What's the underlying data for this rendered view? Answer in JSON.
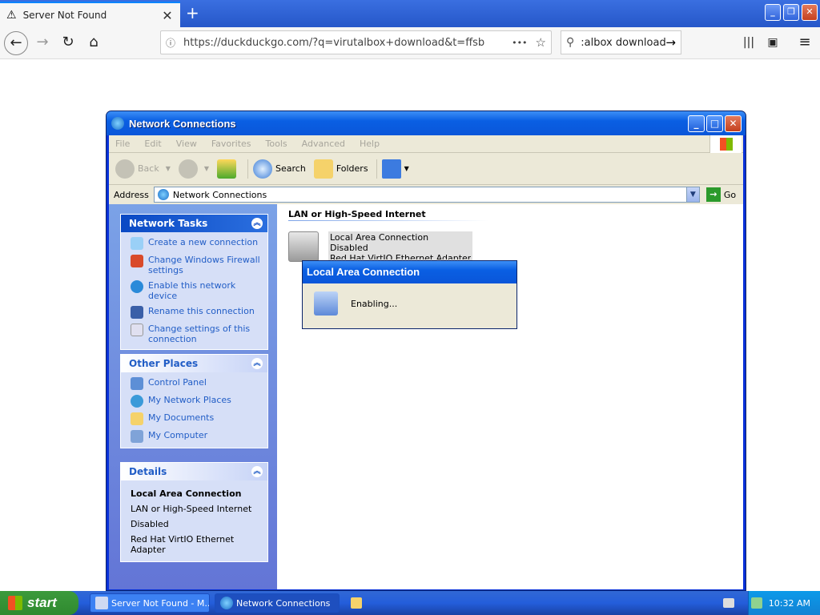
{
  "browser": {
    "tab_title": "Server Not Found",
    "tab_close": "✕",
    "new_tab": "+",
    "url": "https://duckduckgo.com/?q=virutalbox+download&t=ffsb",
    "search_text": ":albox download",
    "url_more": "•••"
  },
  "window": {
    "title": "Network Connections",
    "menu": [
      "File",
      "Edit",
      "View",
      "Favorites",
      "Tools",
      "Advanced",
      "Help"
    ],
    "toolbar": {
      "back": "Back",
      "search": "Search",
      "folders": "Folders"
    },
    "address_label": "Address",
    "address_value": "Network Connections",
    "go_label": "Go"
  },
  "tasks": {
    "network_tasks_title": "Network Tasks",
    "network_tasks": [
      "Create a new connection",
      "Change Windows Firewall settings",
      "Enable this network device",
      "Rename this connection",
      "Change settings of this connection"
    ],
    "other_places_title": "Other Places",
    "other_places": [
      "Control Panel",
      "My Network Places",
      "My Documents",
      "My Computer"
    ],
    "details_title": "Details",
    "details": {
      "name": "Local Area Connection",
      "type": "LAN or High-Speed Internet",
      "status": "Disabled",
      "adapter": "Red Hat VirtIO Ethernet Adapter"
    }
  },
  "content": {
    "group_header": "LAN or High-Speed Internet",
    "item": {
      "name": "Local Area Connection",
      "status": "Disabled",
      "adapter": "Red Hat VirtIO Ethernet Adapter"
    }
  },
  "dialog": {
    "title": "Local Area Connection",
    "message": "Enabling..."
  },
  "taskbar": {
    "start": "start",
    "buttons": [
      "Server Not Found - M...",
      "Network Connections"
    ],
    "clock": "10:32 AM"
  }
}
